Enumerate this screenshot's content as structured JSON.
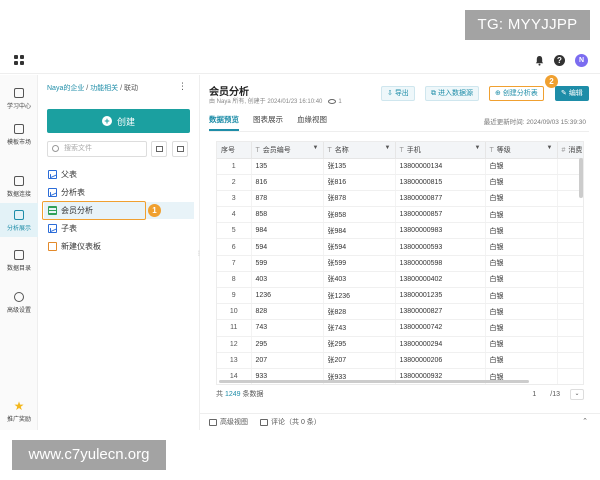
{
  "watermarks": {
    "top": "TG: MYYJJPP",
    "bottom": "www.c7yulecn.org"
  },
  "topbar": {
    "avatar_initial": "N",
    "help_glyph": "?"
  },
  "rail": [
    {
      "label": "学习中心",
      "icon": "graduation-icon",
      "active": false
    },
    {
      "label": "模板市场",
      "icon": "template-icon",
      "active": false
    },
    {
      "label": "数据连接",
      "icon": "database-icon",
      "active": false
    },
    {
      "label": "分析展示",
      "icon": "chart-icon",
      "active": true
    },
    {
      "label": "数据目录",
      "icon": "catalog-icon",
      "active": false
    },
    {
      "label": "高级设置",
      "icon": "settings-icon",
      "active": false
    },
    {
      "label": "推广奖励",
      "icon": "star-icon",
      "active": false
    }
  ],
  "panel": {
    "breadcrumb": {
      "org": "Naya的企业",
      "sep1": " / ",
      "folder": "功能相关",
      "sep2": " / ",
      "current": "联动"
    },
    "more": "⋮",
    "create_label": "创建",
    "search_placeholder": "搜索文件",
    "tree": [
      {
        "label": "父表",
        "kind": "chart"
      },
      {
        "label": "分析表",
        "kind": "chart"
      },
      {
        "label": "会员分析",
        "kind": "table",
        "selected": true
      },
      {
        "label": "子表",
        "kind": "chart"
      },
      {
        "label": "新建仪表板",
        "kind": "dash"
      }
    ],
    "step_badge": "1"
  },
  "main": {
    "title": "会员分析",
    "subtitle": "由 Naya 所有, 创建于 2024/01/23 16:10:40",
    "view_count": "1",
    "buttons": {
      "export": "导出",
      "enter_source": "进入数据源",
      "create_analysis": "创建分析表",
      "edit": "编辑"
    },
    "step_badge": "2",
    "tabs": [
      "数据预览",
      "图表展示",
      "血缘视图"
    ],
    "updated": "最近更新时间: 2024/09/03 15:39:30",
    "table": {
      "columns": [
        {
          "label": "序号",
          "typed": false
        },
        {
          "label": "会员编号",
          "typed": true
        },
        {
          "label": "名称",
          "typed": true
        },
        {
          "label": "手机",
          "typed": true
        },
        {
          "label": "等级",
          "typed": true
        },
        {
          "label": "消费",
          "typed": true,
          "hash": true
        }
      ],
      "rows": [
        [
          "1",
          "135",
          "张135",
          "13800000134",
          "白银"
        ],
        [
          "2",
          "816",
          "张816",
          "13800000815",
          "白银"
        ],
        [
          "3",
          "878",
          "张878",
          "13800000877",
          "白银"
        ],
        [
          "4",
          "858",
          "张858",
          "13800000857",
          "白银"
        ],
        [
          "5",
          "984",
          "张984",
          "13800000983",
          "白银"
        ],
        [
          "6",
          "594",
          "张594",
          "13800000593",
          "白银"
        ],
        [
          "7",
          "599",
          "张599",
          "13800000598",
          "白银"
        ],
        [
          "8",
          "403",
          "张403",
          "13800000402",
          "白银"
        ],
        [
          "9",
          "1236",
          "张1236",
          "13800001235",
          "白银"
        ],
        [
          "10",
          "828",
          "张828",
          "13800000827",
          "白银"
        ],
        [
          "11",
          "743",
          "张743",
          "13800000742",
          "白银"
        ],
        [
          "12",
          "295",
          "张295",
          "13800000294",
          "白银"
        ],
        [
          "13",
          "207",
          "张207",
          "13800000206",
          "白银"
        ],
        [
          "14",
          "933",
          "张933",
          "13800000932",
          "白银"
        ]
      ]
    },
    "footer": {
      "prefix": "共",
      "count": "1249",
      "suffix": "条数据",
      "page": "1",
      "total_pages": "/13"
    }
  },
  "bottombar": {
    "advanced_view": "高级视图",
    "comments": "评论（共 0 条）"
  }
}
